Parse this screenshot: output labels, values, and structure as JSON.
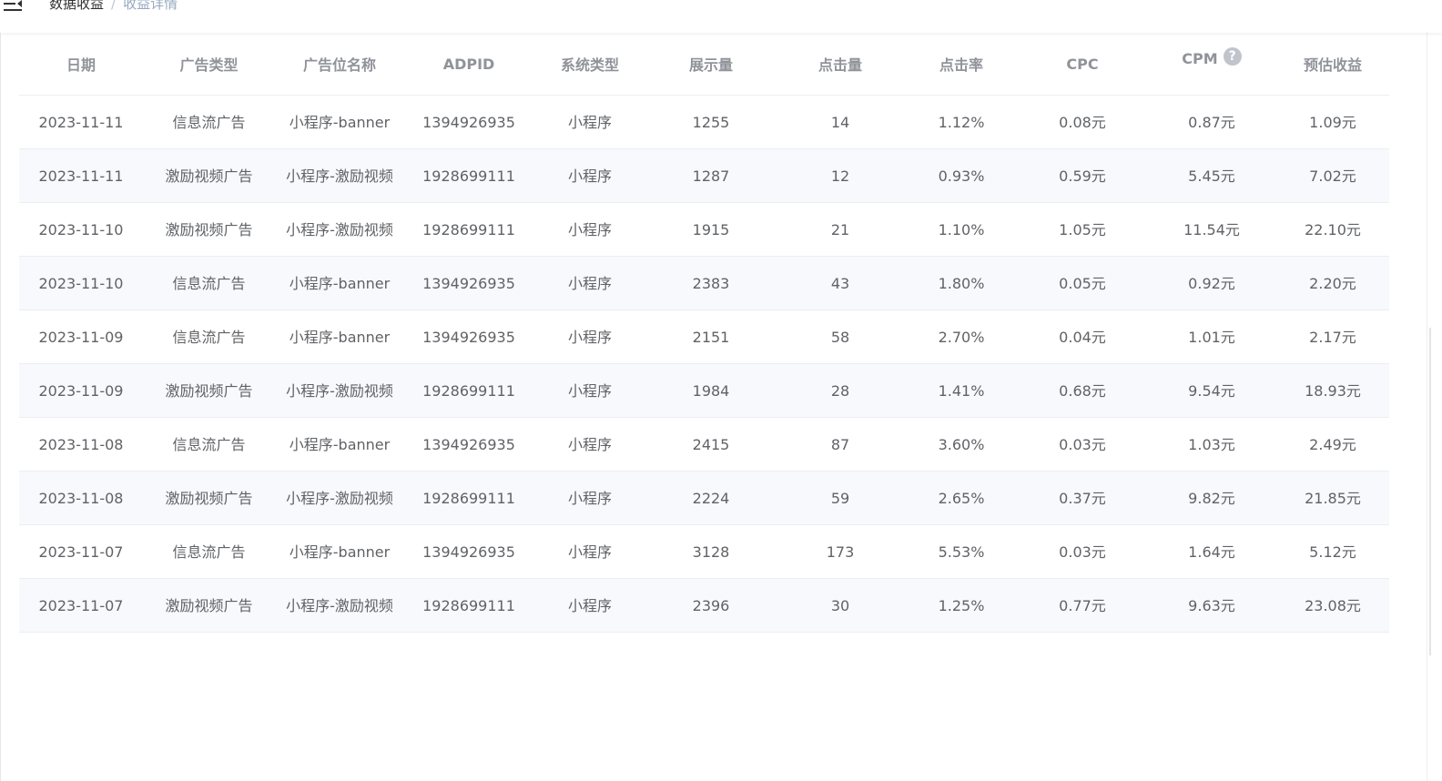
{
  "breadcrumb": {
    "root": "数据收益",
    "separator": "/",
    "current": "收益详情"
  },
  "table": {
    "columns": [
      "日期",
      "广告类型",
      "广告位名称",
      "ADPID",
      "系统类型",
      "展示量",
      "点击量",
      "点击率",
      "CPC",
      "CPM",
      "预估收益"
    ],
    "rows": [
      [
        "2023-11-11",
        "信息流广告",
        "小程序-banner",
        "1394926935",
        "小程序",
        "1255",
        "14",
        "1.12%",
        "0.08元",
        "0.87元",
        "1.09元"
      ],
      [
        "2023-11-11",
        "激励视频广告",
        "小程序-激励视频",
        "1928699111",
        "小程序",
        "1287",
        "12",
        "0.93%",
        "0.59元",
        "5.45元",
        "7.02元"
      ],
      [
        "2023-11-10",
        "激励视频广告",
        "小程序-激励视频",
        "1928699111",
        "小程序",
        "1915",
        "21",
        "1.10%",
        "1.05元",
        "11.54元",
        "22.10元"
      ],
      [
        "2023-11-10",
        "信息流广告",
        "小程序-banner",
        "1394926935",
        "小程序",
        "2383",
        "43",
        "1.80%",
        "0.05元",
        "0.92元",
        "2.20元"
      ],
      [
        "2023-11-09",
        "信息流广告",
        "小程序-banner",
        "1394926935",
        "小程序",
        "2151",
        "58",
        "2.70%",
        "0.04元",
        "1.01元",
        "2.17元"
      ],
      [
        "2023-11-09",
        "激励视频广告",
        "小程序-激励视频",
        "1928699111",
        "小程序",
        "1984",
        "28",
        "1.41%",
        "0.68元",
        "9.54元",
        "18.93元"
      ],
      [
        "2023-11-08",
        "信息流广告",
        "小程序-banner",
        "1394926935",
        "小程序",
        "2415",
        "87",
        "3.60%",
        "0.03元",
        "1.03元",
        "2.49元"
      ],
      [
        "2023-11-08",
        "激励视频广告",
        "小程序-激励视频",
        "1928699111",
        "小程序",
        "2224",
        "59",
        "2.65%",
        "0.37元",
        "9.82元",
        "21.85元"
      ],
      [
        "2023-11-07",
        "信息流广告",
        "小程序-banner",
        "1394926935",
        "小程序",
        "3128",
        "173",
        "5.53%",
        "0.03元",
        "1.64元",
        "5.12元"
      ],
      [
        "2023-11-07",
        "激励视频广告",
        "小程序-激励视频",
        "1928699111",
        "小程序",
        "2396",
        "30",
        "1.25%",
        "0.77元",
        "9.63元",
        "23.08元"
      ]
    ]
  },
  "icons": {
    "menu": "hamburger-icon",
    "help": "question-circle-icon",
    "help_glyph": "?"
  },
  "colors": {
    "header_text": "#909399",
    "cell_text": "#606266",
    "stripe_bg": "#f7f9fc",
    "border": "#ebeef5"
  }
}
